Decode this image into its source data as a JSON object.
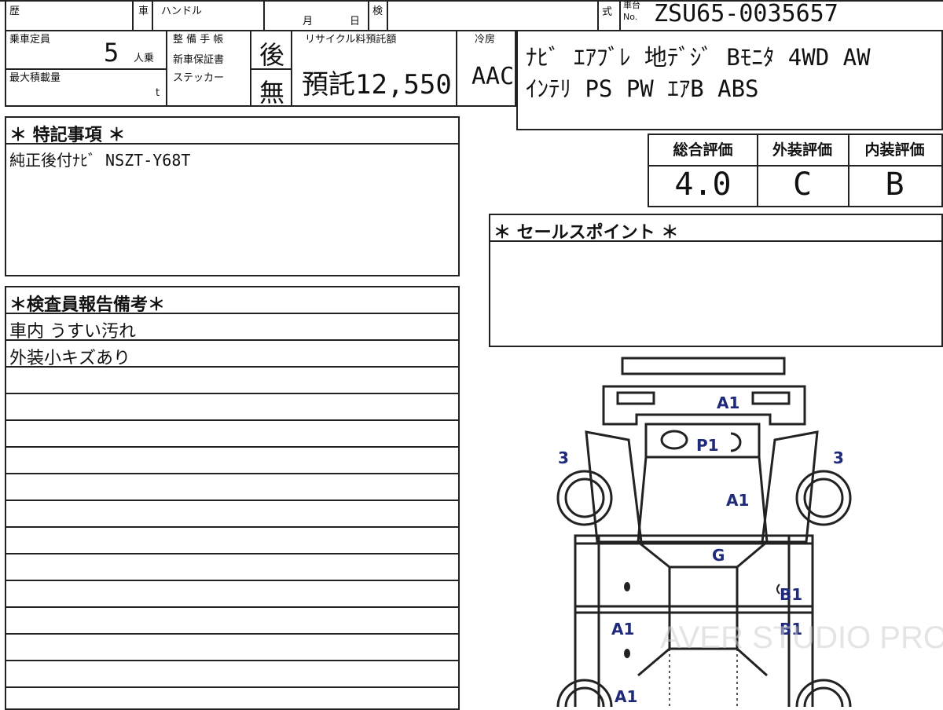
{
  "header": {
    "history_label": "歴",
    "vehicle_label": "車",
    "handle_label": "ハンドル",
    "month_label": "月",
    "day_label": "日",
    "inspection_label": "検",
    "type_label": "式",
    "chassis_label_top": "車台",
    "chassis_label_bottom": "No.",
    "chassis_no": "ZSU65-0035657"
  },
  "specs": {
    "capacity_label": "乗車定員",
    "capacity_value": "5",
    "capacity_unit": "人乗",
    "max_load_label": "最大積載量",
    "max_load_unit": "t",
    "maint_label": "整 備 手 帳",
    "warranty_label": "新車保証書",
    "maint_value": "後",
    "sticker_label": "ステッカー",
    "sticker_value": "無",
    "recycle_label": "リサイクル料預託額",
    "recycle_value": "預託12,550",
    "aircon_label": "冷房",
    "aircon_value": "AAC"
  },
  "equipment": {
    "line1": "ﾅﾋﾞ ｴｱﾌﾞﾚ 地ﾃﾞｼﾞ Bﾓﾆﾀ 4WD AW",
    "line2": "ｲﾝﾃﾘ PS PW ｴｱB ABS"
  },
  "special_notes": {
    "title": "＊ 特記事項 ＊",
    "text": "純正後付ﾅﾋﾞ NSZT-Y68T"
  },
  "ratings": {
    "overall_label": "総合評価",
    "overall_value": "4.0",
    "exterior_label": "外装評価",
    "exterior_value": "C",
    "interior_label": "内装評価",
    "interior_value": "B"
  },
  "sale_points": {
    "title": "＊ セールスポイント ＊"
  },
  "inspector_report": {
    "title": "＊検査員報告備考＊",
    "lines": [
      "車内 うすい汚れ",
      "外装小キズあり"
    ]
  },
  "damage_map": {
    "labels": {
      "front_bumper": "A1",
      "front_glass": "P1",
      "left_front_wheel": "3",
      "right_front_wheel": "3",
      "right_fender": "A1",
      "roof": "G",
      "right_front_door": "B1",
      "right_rear_door": "B1",
      "left_rear_door": "A1",
      "left_rear_fender": "A1"
    },
    "watermark": "AVER STUDIO PRO"
  }
}
